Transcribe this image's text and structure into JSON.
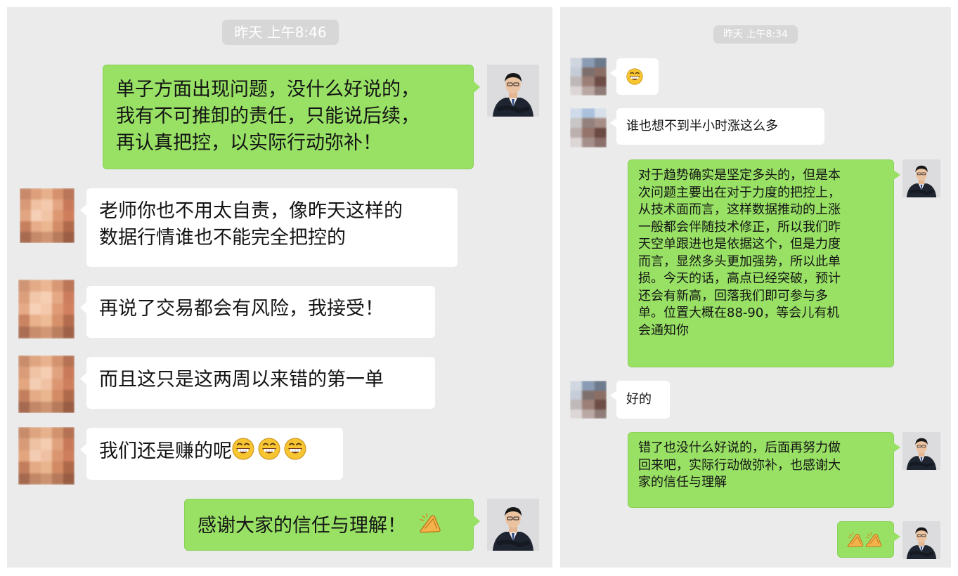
{
  "left_chat": {
    "timestamp": "昨天 上午8:46",
    "messages": [
      {
        "sender": "self",
        "lines": [
          "单子方面出现问题，没什么好说的，",
          "我有不可推卸的责任，只能说后续，",
          "再认真把控，以实际行动弥补！"
        ]
      },
      {
        "sender": "other",
        "lines": [
          "老师你也不用太自责，像昨天这样的",
          "数据行情谁也不能完全把控的"
        ]
      },
      {
        "sender": "other",
        "lines": [
          "再说了交易都会有风险，我接受！"
        ]
      },
      {
        "sender": "other",
        "lines": [
          "而且这只是这两周以来错的第一单"
        ]
      },
      {
        "sender": "other",
        "text": "我们还是赚的呢",
        "emojis": [
          "grin-icon",
          "grin-icon",
          "grin-icon"
        ]
      },
      {
        "sender": "self",
        "text": "感谢大家的信任与理解！",
        "emojis": [
          "clap-icon"
        ]
      }
    ]
  },
  "right_chat": {
    "timestamp": "昨天 上午8:34",
    "messages": [
      {
        "sender": "other",
        "emojis": [
          "grin-icon"
        ]
      },
      {
        "sender": "other",
        "text": "谁也想不到半小时涨这么多"
      },
      {
        "sender": "self",
        "lines": [
          "对于趋势确实是坚定多头的，但是本",
          "次问题主要出在对于力度的把控上，",
          "从技术面而言，这样数据推动的上涨",
          "一般都会伴随技术修正，所以我们昨",
          "天空单跟进也是依据这个，但是力度",
          "而言，显然多头更加强势，所以此单",
          "损。今天的话，高点已经突破，预计",
          "还会有新高，回落我们即可参与多",
          "单。位置大概在88-90，等会儿有机",
          "会通知你"
        ]
      },
      {
        "sender": "other",
        "text": "好的"
      },
      {
        "sender": "self",
        "lines": [
          "错了也没什么好说的，后面再努力做",
          "回来吧，实际行动做弥补，也感谢大",
          "家的信任与理解"
        ]
      },
      {
        "sender": "self",
        "emojis": [
          "clap-icon",
          "clap-icon"
        ]
      }
    ]
  },
  "colors": {
    "background": "#ebebeb",
    "self_bubble": "#98e165",
    "other_bubble": "#ffffff",
    "timestamp_chip": "#d7d7d7"
  }
}
